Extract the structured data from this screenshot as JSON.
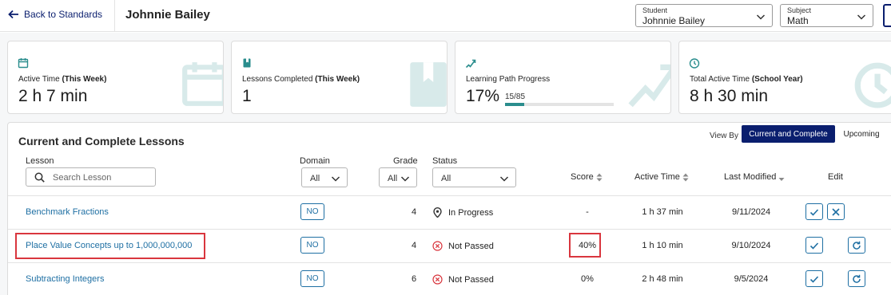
{
  "header": {
    "back_label": "Back to Standards",
    "title": "Johnnie Bailey",
    "student_select": {
      "label": "Student",
      "value": "Johnnie Bailey"
    },
    "subject_select": {
      "label": "Subject",
      "value": "Math"
    }
  },
  "stats": [
    {
      "label": "Active Time",
      "label_bold": "(This Week)",
      "value": "2 h 7 min",
      "icon": "calendar-icon"
    },
    {
      "label": "Lessons Completed",
      "label_bold": "(This Week)",
      "value": "1",
      "icon": "book-icon"
    },
    {
      "label": "Learning Path Progress",
      "label_bold": "",
      "value": "17%",
      "icon": "trend-icon",
      "progress_text": "15/85",
      "progress_fraction": 0.1765
    },
    {
      "label": "Total Active Time",
      "label_bold": "(School Year)",
      "value": "8 h 30 min",
      "icon": "clock-icon"
    }
  ],
  "lessons": {
    "title": "Current and Complete Lessons",
    "view_by_label": "View By",
    "view_options": [
      "Current and Complete",
      "Upcoming"
    ],
    "active_view": "Current and Complete",
    "columns": {
      "lesson": "Lesson",
      "domain": "Domain",
      "grade": "Grade",
      "status": "Status",
      "score": "Score",
      "active_time": "Active Time",
      "last_modified": "Last Modified",
      "edit": "Edit"
    },
    "filters": {
      "search_placeholder": "Search Lesson",
      "domain_value": "All",
      "grade_value": "All",
      "status_value": "All"
    },
    "rows": [
      {
        "lesson": "Benchmark Fractions",
        "domain": "NO",
        "grade": "4",
        "status": "In Progress",
        "status_icon": "location-pin-icon",
        "score": "-",
        "active_time": "1 h 37 min",
        "last_modified": "9/11/2024",
        "actions": [
          "check",
          "close"
        ]
      },
      {
        "lesson": "Place Value Concepts up to 1,000,000,000",
        "domain": "NO",
        "grade": "4",
        "status": "Not Passed",
        "status_icon": "x-circle-icon",
        "score": "40%",
        "active_time": "1 h 10 min",
        "last_modified": "9/10/2024",
        "actions": [
          "check",
          "retry"
        ]
      },
      {
        "lesson": "Subtracting Integers",
        "domain": "NO",
        "grade": "6",
        "status": "Not Passed",
        "status_icon": "x-circle-icon",
        "score": "0%",
        "active_time": "2 h 48 min",
        "last_modified": "9/5/2024",
        "actions": [
          "check",
          "retry"
        ]
      }
    ]
  },
  "colors": {
    "brand": "#0a1e6e",
    "link": "#1e6fa3",
    "highlight": "#d9363e",
    "progress": "#2a8d8d"
  }
}
